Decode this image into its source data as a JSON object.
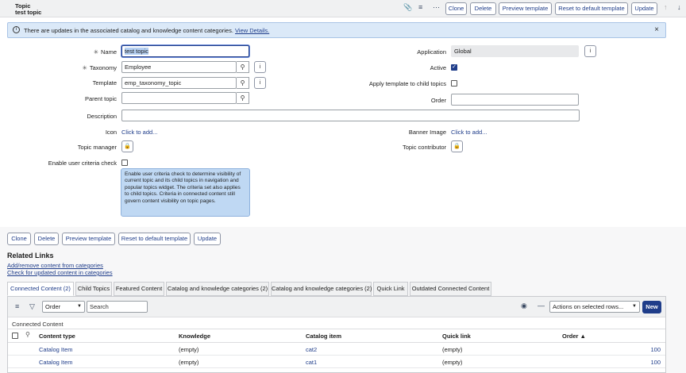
{
  "header": {
    "title_type": "Topic",
    "title_name": "test topic",
    "buttons": {
      "clone": "Clone",
      "delete": "Delete",
      "preview": "Preview template",
      "reset": "Reset to default template",
      "update": "Update"
    },
    "icons": [
      "paperclip-icon",
      "settings-sliders-icon",
      "more-icon",
      "arrow-up-icon",
      "arrow-down-icon"
    ]
  },
  "banner": {
    "message": "There are updates in the associated catalog and knowledge content categories.",
    "link": "View Details."
  },
  "form": {
    "name": {
      "label": "Name",
      "value": "test topic"
    },
    "taxonomy": {
      "label": "Taxonomy",
      "value": "Employee"
    },
    "template": {
      "label": "Template",
      "value": "emp_taxonomy_topic"
    },
    "parent_topic": {
      "label": "Parent topic",
      "value": ""
    },
    "description": {
      "label": "Description",
      "value": ""
    },
    "icon": {
      "label": "Icon",
      "link": "Click to add..."
    },
    "topic_manager": {
      "label": "Topic manager"
    },
    "enable_user_criteria": {
      "label": "Enable user criteria check",
      "checked": false
    },
    "tooltip": "Enable user criteria check to determine visibility of current topic and its child topics in navigation and popular topics widget. The criteria set also applies to child topics. Criteria in connected content still govern content visibility on topic pages.",
    "application": {
      "label": "Application",
      "value": "Global"
    },
    "active": {
      "label": "Active",
      "checked": true
    },
    "apply_template": {
      "label": "Apply template to child topics",
      "checked": false
    },
    "order": {
      "label": "Order",
      "value": ""
    },
    "banner_image": {
      "label": "Banner Image",
      "link": "Click to add..."
    },
    "topic_contributor": {
      "label": "Topic contributor"
    }
  },
  "bottom_buttons": {
    "clone": "Clone",
    "delete": "Delete",
    "preview": "Preview template",
    "reset": "Reset to default template",
    "update": "Update"
  },
  "related_links": {
    "title": "Related Links",
    "links": [
      "Add/remove content from categories",
      "Check for updated content in categories"
    ]
  },
  "tabs": [
    {
      "label": "Connected Content (2)",
      "active": true
    },
    {
      "label": "Child Topics"
    },
    {
      "label": "Featured Content"
    },
    {
      "label": "Catalog and knowledge categories (2)"
    },
    {
      "label": "Catalog and knowledge categories (2)"
    },
    {
      "label": "Quick Link"
    },
    {
      "label": "Outdated Connected Content"
    }
  ],
  "list": {
    "filter_field": "Order",
    "search_placeholder": "Search",
    "actions": "Actions on selected rows...",
    "new": "New",
    "caption": "Connected Content",
    "columns": [
      "Content type",
      "Knowledge",
      "Catalog item",
      "Quick link",
      "Order"
    ],
    "rows": [
      [
        "Catalog Item",
        "(empty)",
        "cat2",
        "(empty)",
        "100"
      ],
      [
        "Catalog Item",
        "(empty)",
        "cat1",
        "(empty)",
        "100"
      ]
    ]
  }
}
